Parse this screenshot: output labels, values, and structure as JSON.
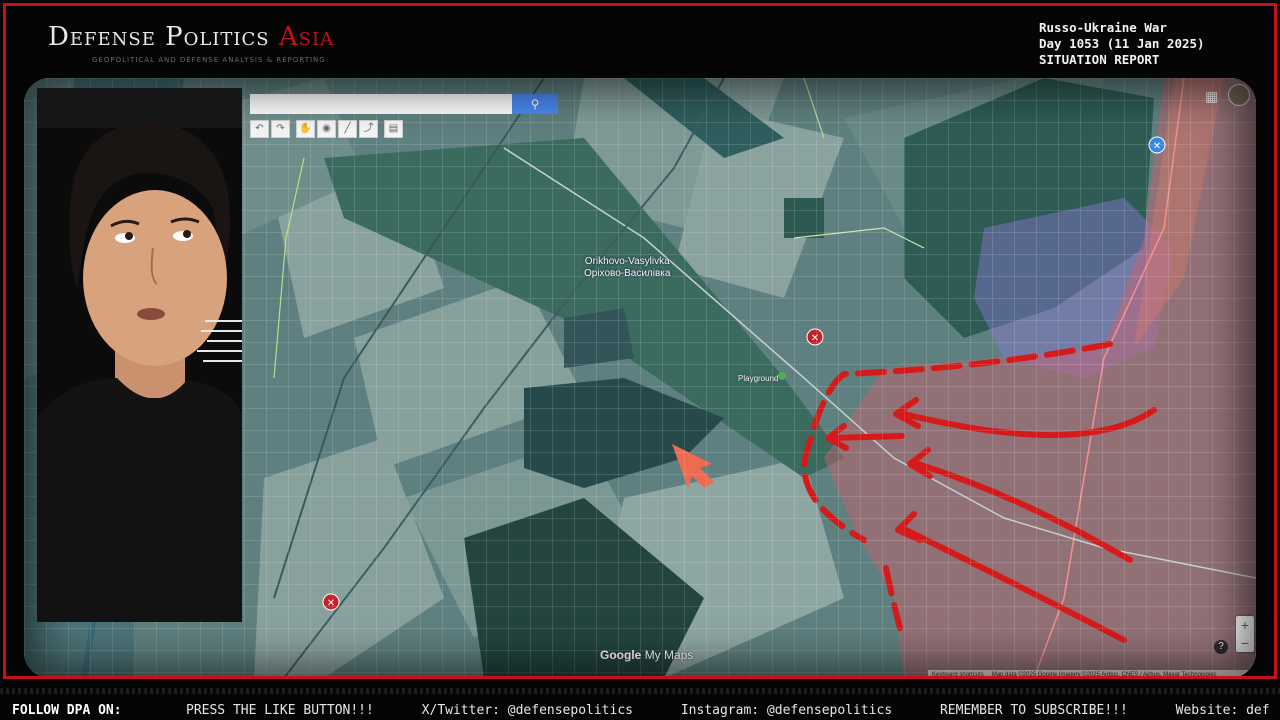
{
  "header": {
    "brand": "Defense Politics",
    "brand_accent": "Asia",
    "tagline": "GEOPOLITICAL AND DEFENSE ANALYSIS & REPORTING",
    "report_line1": "Russo-Ukraine War",
    "report_line2": "Day 1053 (11 Jan 2025)",
    "report_line3": "SITUATION REPORT"
  },
  "map": {
    "search": {
      "value": "",
      "placeholder": ""
    },
    "search_button_icon": "search-icon",
    "tools": [
      "undo-icon",
      "redo-icon",
      "hand-icon",
      "marker-icon",
      "draw-line-icon",
      "directions-icon",
      "ruler-icon"
    ],
    "place_label_latin": "Orikhovo-Vasylivka",
    "place_label_cyrillic": "Орiхово-Василiвка",
    "poi_label": "Playground",
    "logo_google": "Google",
    "logo_mymaps": "My Maps",
    "attribution": [
      "Keyboard shortcuts",
      "Map data ©2025 Google Imagery ©2025 Airbus, CNES / Airbus, Maxar Technologies"
    ],
    "zoom_in": "+",
    "zoom_out": "−",
    "help": "?",
    "colors": {
      "russian_zone": "#d85c6a",
      "contested_zone": "#8a78d8",
      "arrow": "#d61a1a",
      "marker_red": "#c8202a",
      "marker_blue": "#3a86e8"
    }
  },
  "ticker": {
    "label": "FOLLOW DPA ON:",
    "items": [
      "PRESS THE LIKE BUTTON!!!",
      "X/Twitter: @defensepolitics",
      "Instagram: @defensepolitics",
      "REMEMBER TO SUBSCRIBE!!!",
      "Website: def"
    ]
  }
}
